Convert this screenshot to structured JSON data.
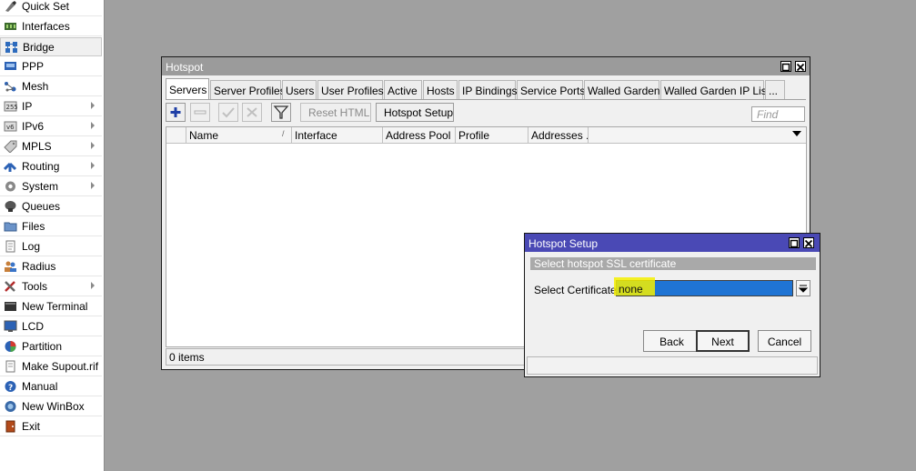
{
  "sidebar": {
    "items": [
      {
        "label": "Quick Set",
        "icon": "quick-set-icon",
        "submenu": false
      },
      {
        "label": "Interfaces",
        "icon": "interfaces-icon",
        "submenu": false
      },
      {
        "label": "Bridge",
        "icon": "bridge-icon",
        "submenu": false
      },
      {
        "label": "PPP",
        "icon": "ppp-icon",
        "submenu": false
      },
      {
        "label": "Mesh",
        "icon": "mesh-icon",
        "submenu": false
      },
      {
        "label": "IP",
        "icon": "ip-icon",
        "submenu": true
      },
      {
        "label": "IPv6",
        "icon": "ipv6-icon",
        "submenu": true
      },
      {
        "label": "MPLS",
        "icon": "mpls-icon",
        "submenu": true
      },
      {
        "label": "Routing",
        "icon": "routing-icon",
        "submenu": true
      },
      {
        "label": "System",
        "icon": "system-icon",
        "submenu": true
      },
      {
        "label": "Queues",
        "icon": "queues-icon",
        "submenu": false
      },
      {
        "label": "Files",
        "icon": "files-icon",
        "submenu": false
      },
      {
        "label": "Log",
        "icon": "log-icon",
        "submenu": false
      },
      {
        "label": "Radius",
        "icon": "radius-icon",
        "submenu": false
      },
      {
        "label": "Tools",
        "icon": "tools-icon",
        "submenu": true
      },
      {
        "label": "New Terminal",
        "icon": "terminal-icon",
        "submenu": false
      },
      {
        "label": "LCD",
        "icon": "lcd-icon",
        "submenu": false
      },
      {
        "label": "Partition",
        "icon": "partition-icon",
        "submenu": false
      },
      {
        "label": "Make Supout.rif",
        "icon": "supout-icon",
        "submenu": false
      },
      {
        "label": "Manual",
        "icon": "manual-icon",
        "submenu": false
      },
      {
        "label": "New WinBox",
        "icon": "winbox-icon",
        "submenu": false
      },
      {
        "label": "Exit",
        "icon": "exit-icon",
        "submenu": false
      }
    ]
  },
  "hotspot_window": {
    "title": "Hotspot",
    "tabs": [
      "Servers",
      "Server Profiles",
      "Users",
      "User Profiles",
      "Active",
      "Hosts",
      "IP Bindings",
      "Service Ports",
      "Walled Garden",
      "Walled Garden IP List",
      "..."
    ],
    "active_tab": "Servers",
    "toolbar": {
      "add_icon": "plus-icon",
      "remove_icon": "minus-icon",
      "enable_icon": "check-icon",
      "disable_icon": "cross-icon",
      "filter_icon": "filter-icon",
      "reset_html_label": "Reset HTML",
      "hotspot_setup_label": "Hotspot Setup"
    },
    "find_placeholder": "Find",
    "table": {
      "columns": [
        "Name",
        "Interface",
        "Address Pool",
        "Profile",
        "Addresses ..."
      ],
      "rows": []
    },
    "status": "0 items"
  },
  "setup_dialog": {
    "title": "Hotspot Setup",
    "subtitle": "Select hotspot SSL certificate",
    "certificate_label": "Select Certificate:",
    "certificate_value": "none",
    "buttons": {
      "back": "Back",
      "next": "Next",
      "cancel": "Cancel"
    }
  },
  "colors": {
    "desktop": "#a0a0a0",
    "hotspot_titlebar": "#9b9b9b",
    "dialog_titlebar": "#4a49b5",
    "selection_blue": "#1f74d4",
    "highlight_yellow": "#f4f000"
  }
}
